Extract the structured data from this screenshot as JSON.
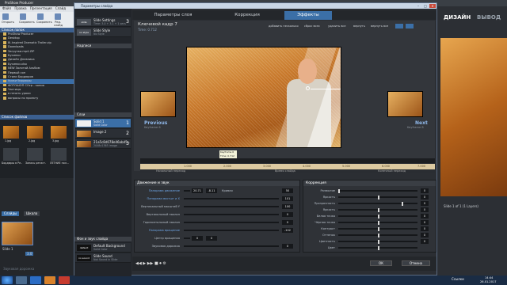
{
  "app": {
    "title": "ProShow Producer",
    "menu": [
      "Файл",
      "Правка",
      "Презентация",
      "Слайд"
    ],
    "toolbar": [
      "Открыть",
      "Сохранить",
      "Сохранить",
      "Ред. слайд"
    ],
    "folder_header": "Список папок",
    "folders": [
      "ProShow Producer",
      "Desktop",
      "8i-Inspired Dramatic Trailer.zip",
      "Downloads",
      "Загрузки.mp4.ZIP",
      "Бусинки",
      "Дизайн Дневника",
      "Бусинки.xlsx",
      "NEW Золотой Альбом",
      "Первый сон",
      "Стили Бордюров",
      "Уроки бордюры",
      "ФОТОШОП СОср - копия",
      "Частицы",
      "в печать уроки",
      "вопросы по проекту"
    ],
    "file_header": "Список файлов",
    "files": [
      "1.jpg",
      "2.jpg",
      "3.jpg",
      "Бордюры в Ре...",
      "Запись регист...",
      "ЛЕТНИЕ пол..."
    ],
    "timeline_tabs": [
      "Слайды",
      "Шкала"
    ],
    "slide1": "Slide 1",
    "slide1_dur": "3.0",
    "timeline_hint": "Звуковая дорожка",
    "right_tabs": [
      "ДИЗАЙН",
      "ВЫВОД"
    ],
    "right_status": "Slide 1 of 1 (1 Layers)",
    "taskbar_time": "14:44",
    "taskbar_date": "26.01.2017",
    "taskbar_links": "Ссылки"
  },
  "dialog": {
    "title": "Параметры слайда",
    "tabs": [
      "Параметры слоя",
      "Коррекция",
      "Эффекты"
    ],
    "keyframe_title": "Ключевой кадр 7",
    "keyframe_time": "Time: 0.712",
    "slide_options": {
      "label": "Slide Settings",
      "sub": "Time: 3.0 + 3.1 + 1 secs",
      "num": "3",
      "icon": "slide"
    },
    "slide_style": {
      "label": "Slide Style",
      "sub": "No Style",
      "icon": "no style"
    },
    "captions_header": "Надписи",
    "layers_header": "Слои",
    "layers": [
      {
        "name": "Solid 1",
        "sub": "Solid Color",
        "num": "1"
      },
      {
        "name": "Image 2",
        "sub": "",
        "num": "2"
      },
      {
        "name": "21a5c8d078e46abd5...",
        "sub": "2048x1365 image",
        "num": "3"
      }
    ],
    "bg_header": "Фон и звук слайда",
    "bg_items": [
      {
        "name": "Default Background",
        "sub": "Solid Color",
        "icon": "default"
      },
      {
        "name": "Slide Sound",
        "sub": "Not Sound in Slide",
        "icon": "no sound"
      }
    ],
    "toolline": [
      "добавить несколько",
      "сброс всех",
      "удалить все",
      "вернуть",
      "вернуть все"
    ],
    "prev_label": "Previous",
    "prev_sub": "Keyframe 6",
    "next_label": "Next",
    "next_sub": "Keyframe 8",
    "tooltip": [
      "Keyframe 6",
      "Time: 0.712"
    ],
    "ruler_labels": [
      "1.000",
      "2.000",
      "3.000",
      "4.000",
      "5.000",
      "6.000",
      "7.000"
    ],
    "ruler_sub": [
      "Начальный переход",
      "Время слайда",
      "Конечный переход"
    ],
    "motion_panel": {
      "title": "Движение и звук",
      "rows": [
        {
          "label": "Панорама движение",
          "blue": true,
          "val1": "20.71",
          "val2": "-8.11",
          "extra": "Кривая",
          "val3": "50"
        },
        {
          "label": "Панорама мастшт и X",
          "blue": true,
          "val1": "",
          "val2": "",
          "val3": "101"
        },
        {
          "label": "Вертикальный масштаб Y",
          "blue": false,
          "val1": "",
          "val2": "",
          "val3": "100"
        },
        {
          "label": "Вертикальный наклон",
          "blue": false,
          "val1": "",
          "val2": "",
          "val3": "0"
        },
        {
          "label": "Горизонтальный наклон",
          "blue": false,
          "val1": "",
          "val2": "",
          "val3": "0"
        },
        {
          "label": "Панорама вращение",
          "blue": true,
          "val1": "",
          "val2": "",
          "val3": "-102"
        },
        {
          "label": "Центр вращения",
          "blue": false,
          "val1": "0",
          "val2": "0",
          "val3": ""
        },
        {
          "label": "Звуковая дорожка",
          "blue": false,
          "val1": "",
          "val2": "",
          "val3": "0"
        }
      ]
    },
    "correction_panel": {
      "title": "Коррекция",
      "rows": [
        {
          "label": "Размытие",
          "val": "0"
        },
        {
          "label": "Яркость",
          "val": "0"
        },
        {
          "label": "Прозрачность",
          "val": "0"
        },
        {
          "label": "Яркость",
          "val": "0"
        },
        {
          "label": "Белая точка",
          "val": "0"
        },
        {
          "label": "Чёрная точка",
          "val": "0"
        },
        {
          "label": "Контраст",
          "val": "0"
        },
        {
          "label": "Оттенок",
          "val": "0"
        },
        {
          "label": "Цветность",
          "val": "0"
        },
        {
          "label": "Цвет",
          "val": ""
        }
      ]
    },
    "ok": "ОК",
    "cancel": "Отмена"
  },
  "colors": {
    "accent": "#3b6fa7",
    "preview": "#d08b32"
  }
}
